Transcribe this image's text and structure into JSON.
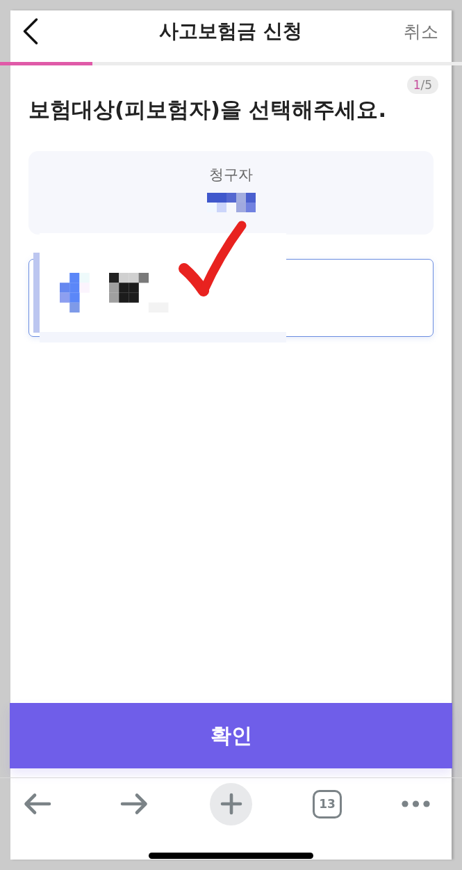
{
  "header": {
    "title": "사고보험금 신청",
    "cancel": "취소"
  },
  "progress": {
    "level": 0.2
  },
  "step_badge": {
    "current": "1",
    "total": "/5"
  },
  "heading": "보험대상(피보험자)을 선택해주세요.",
  "options": [
    {
      "label": "청구자",
      "covered": false,
      "selected": false
    },
    {
      "covered": true,
      "selected": true
    }
  ],
  "annotation": {
    "kind": "checkmark"
  },
  "confirm_button": "확인",
  "browser_toolbar": {
    "tab_count": "13"
  }
}
